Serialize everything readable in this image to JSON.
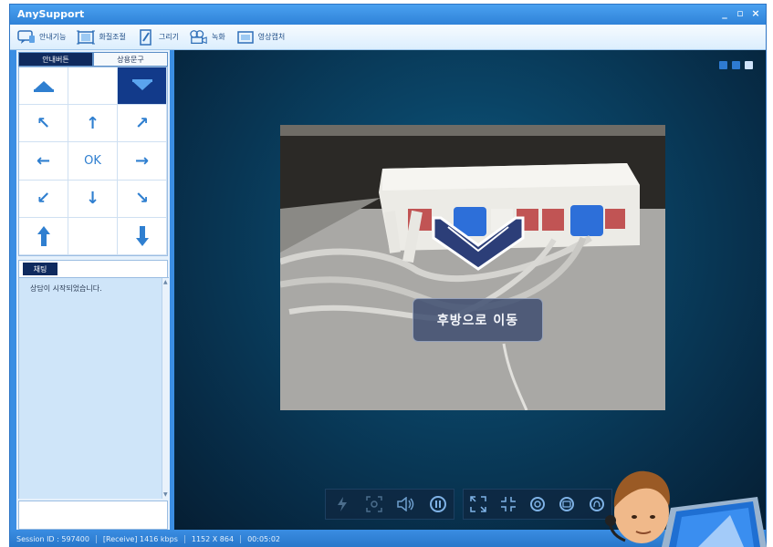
{
  "window": {
    "title": "AnySupport",
    "minimize": "_",
    "maximize": "▫",
    "close": "×"
  },
  "toolbar": [
    {
      "label": "안내기능",
      "icon": "guide-icon"
    },
    {
      "label": "화질조절",
      "icon": "quality-icon"
    },
    {
      "label": "그리기",
      "icon": "draw-icon"
    },
    {
      "label": "녹화",
      "icon": "record-icon"
    },
    {
      "label": "영상캡처",
      "icon": "capture-icon"
    }
  ],
  "left_tabs": {
    "active": "안내버튼",
    "inactive": "상용문구"
  },
  "dpad": {
    "ok_label": "OK"
  },
  "chat": {
    "tab_label": "채팅",
    "message": "상담이 시작되었습니다."
  },
  "viewer": {
    "overlay_label": "후방으로 이동"
  },
  "status": {
    "session": "Session ID : 597400",
    "receive": "[Receive] 1416 kbps",
    "resolution": "1152 X 864",
    "elapsed": "00:05:02"
  },
  "colors": {
    "accent": "#3b8ee3",
    "active_tab": "#0f2a5e",
    "arrow": "#2f7fd0"
  }
}
